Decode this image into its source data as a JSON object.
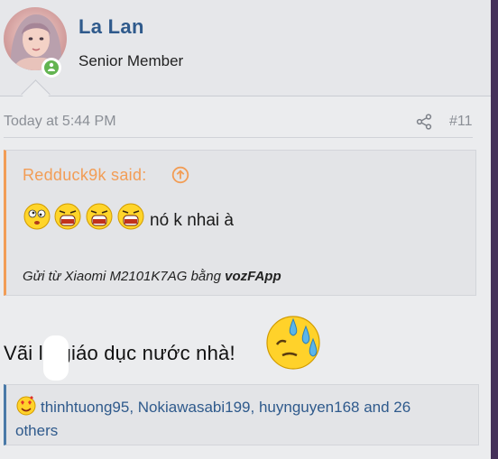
{
  "user": {
    "name": "La Lan",
    "title": "Senior Member"
  },
  "post": {
    "time": "Today at 5:44 PM",
    "number": "#11"
  },
  "quote": {
    "author_label": "Redduck9k said:",
    "text": "nó k nhai à",
    "signature_prefix": "Gửi từ Xiaomi M2101K7AG bằng ",
    "signature_app": "vozFApp"
  },
  "body": {
    "text": "Vãi lo giáo dục nước nhà!"
  },
  "reactions": {
    "text": "thinhtuong95, Nokiawasabi199, huynguyen168 and 26 others"
  },
  "colors": {
    "accent_blue": "#2f5a8c",
    "quote_orange": "#f29d56",
    "online_green": "#63b451"
  },
  "icons": [
    "share-icon",
    "up-arrow-circle-icon",
    "laugh-emoji-icon",
    "sweat-emoji-icon",
    "online-icon"
  ]
}
